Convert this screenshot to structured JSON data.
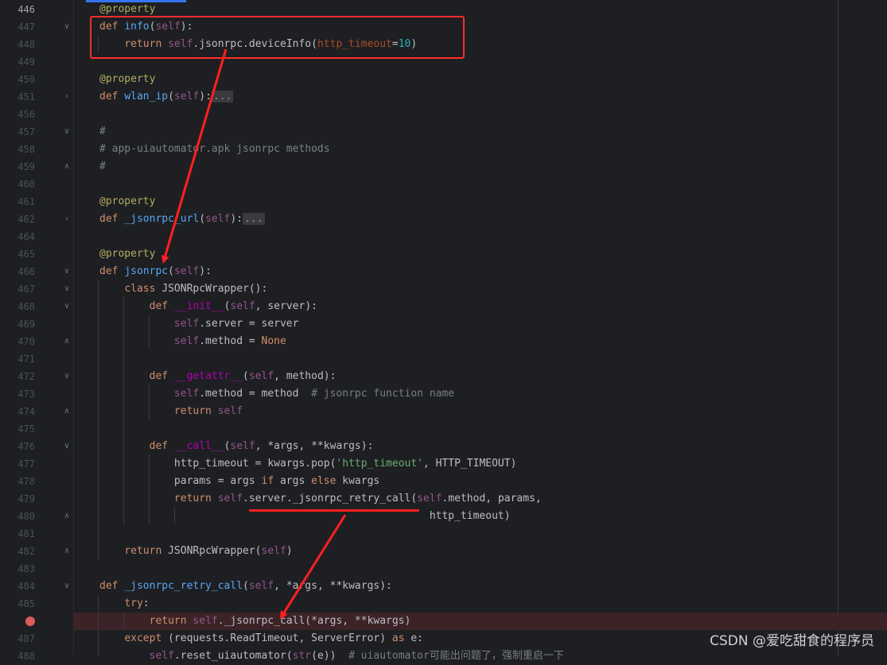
{
  "lines": [
    {
      "n": "446",
      "tokens": [
        [
          "dec",
          "@property"
        ]
      ]
    },
    {
      "n": "447",
      "fold": "v",
      "tokens": [
        [
          "k",
          "def "
        ],
        [
          "f",
          "info"
        ],
        [
          "",
          "("
        ],
        [
          "s",
          "self"
        ],
        [
          "",
          "):"
        ]
      ]
    },
    {
      "n": "448",
      "tokens": [
        [
          "",
          "    "
        ],
        [
          "k",
          "return "
        ],
        [
          "s",
          "self"
        ],
        [
          "",
          ".jsonrpc.deviceInfo("
        ],
        [
          "param",
          "http_timeout"
        ],
        [
          "",
          "="
        ],
        [
          "num",
          "10"
        ],
        [
          "",
          ")"
        ]
      ]
    },
    {
      "n": "449",
      "tokens": []
    },
    {
      "n": "450",
      "tokens": [
        [
          "dec",
          "@property"
        ]
      ]
    },
    {
      "n": "451",
      "fold": ">",
      "tokens": [
        [
          "k",
          "def "
        ],
        [
          "f",
          "wlan_ip"
        ],
        [
          "",
          "("
        ],
        [
          "s",
          "self"
        ],
        [
          "",
          "):"
        ],
        [
          "fb",
          "..."
        ]
      ]
    },
    {
      "n": "456",
      "tokens": []
    },
    {
      "n": "457",
      "fold": "v",
      "tokens": [
        [
          "cm",
          "#"
        ]
      ]
    },
    {
      "n": "458",
      "tokens": [
        [
          "cm",
          "# app-uiautomator.apk jsonrpc methods"
        ]
      ]
    },
    {
      "n": "459",
      "fold": "^",
      "tokens": [
        [
          "cm",
          "#"
        ]
      ]
    },
    {
      "n": "460",
      "tokens": []
    },
    {
      "n": "461",
      "tokens": [
        [
          "dec",
          "@property"
        ]
      ]
    },
    {
      "n": "462",
      "fold": ">",
      "tokens": [
        [
          "k",
          "def "
        ],
        [
          "f",
          "_jsonrpc_url"
        ],
        [
          "",
          "("
        ],
        [
          "s",
          "self"
        ],
        [
          "",
          "):"
        ],
        [
          "fb",
          "..."
        ]
      ]
    },
    {
      "n": "464",
      "tokens": []
    },
    {
      "n": "465",
      "tokens": [
        [
          "dec",
          "@property"
        ]
      ]
    },
    {
      "n": "466",
      "fold": "v",
      "tokens": [
        [
          "k",
          "def "
        ],
        [
          "f",
          "jsonrpc"
        ],
        [
          "",
          "("
        ],
        [
          "s",
          "self"
        ],
        [
          "",
          "):"
        ]
      ]
    },
    {
      "n": "467",
      "fold": "v",
      "tokens": [
        [
          "",
          "    "
        ],
        [
          "k",
          "class "
        ],
        [
          "",
          "JSONRpcWrapper():"
        ]
      ]
    },
    {
      "n": "468",
      "fold": "v",
      "tokens": [
        [
          "",
          "        "
        ],
        [
          "k",
          "def "
        ],
        [
          "dunder",
          "__init__"
        ],
        [
          "",
          "("
        ],
        [
          "s",
          "self"
        ],
        [
          "",
          ", server):"
        ]
      ]
    },
    {
      "n": "469",
      "tokens": [
        [
          "",
          "            "
        ],
        [
          "s",
          "self"
        ],
        [
          "",
          ".server = server"
        ]
      ]
    },
    {
      "n": "470",
      "fold": "^",
      "tokens": [
        [
          "",
          "            "
        ],
        [
          "s",
          "self"
        ],
        [
          "",
          ".method = "
        ],
        [
          "k",
          "None"
        ]
      ]
    },
    {
      "n": "471",
      "tokens": []
    },
    {
      "n": "472",
      "fold": "v",
      "tokens": [
        [
          "",
          "        "
        ],
        [
          "k",
          "def "
        ],
        [
          "dunder",
          "__getattr__"
        ],
        [
          "",
          "("
        ],
        [
          "s",
          "self"
        ],
        [
          "",
          ", method):"
        ]
      ]
    },
    {
      "n": "473",
      "tokens": [
        [
          "",
          "            "
        ],
        [
          "s",
          "self"
        ],
        [
          "",
          ".method = method  "
        ],
        [
          "cm",
          "# jsonrpc function name"
        ]
      ]
    },
    {
      "n": "474",
      "fold": "^",
      "tokens": [
        [
          "",
          "            "
        ],
        [
          "k",
          "return "
        ],
        [
          "s",
          "self"
        ]
      ]
    },
    {
      "n": "475",
      "tokens": []
    },
    {
      "n": "476",
      "fold": "v",
      "tokens": [
        [
          "",
          "        "
        ],
        [
          "k",
          "def "
        ],
        [
          "dunder",
          "__call__"
        ],
        [
          "",
          "("
        ],
        [
          "s",
          "self"
        ],
        [
          "",
          ", *args, **kwargs):"
        ]
      ]
    },
    {
      "n": "477",
      "tokens": [
        [
          "",
          "            http_timeout = kwargs.pop("
        ],
        [
          "str",
          "'http_timeout'"
        ],
        [
          "",
          ", HTTP_TIMEOUT)"
        ]
      ]
    },
    {
      "n": "478",
      "tokens": [
        [
          "",
          "            params = args "
        ],
        [
          "k",
          "if "
        ],
        [
          "",
          "args "
        ],
        [
          "k",
          "else "
        ],
        [
          "",
          "kwargs"
        ]
      ]
    },
    {
      "n": "479",
      "tokens": [
        [
          "",
          "            "
        ],
        [
          "k",
          "return "
        ],
        [
          "s",
          "self"
        ],
        [
          "",
          ".server._jsonrpc_retry_call("
        ],
        [
          "s",
          "self"
        ],
        [
          "",
          ".method, params,"
        ]
      ]
    },
    {
      "n": "480",
      "fold": "^",
      "tokens": [
        [
          "",
          "                                                     http_timeout)"
        ]
      ]
    },
    {
      "n": "481",
      "tokens": []
    },
    {
      "n": "482",
      "fold": "^",
      "tokens": [
        [
          "",
          "    "
        ],
        [
          "k",
          "return "
        ],
        [
          "",
          "JSONRpcWrapper("
        ],
        [
          "s",
          "self"
        ],
        [
          "",
          ")"
        ]
      ]
    },
    {
      "n": "483",
      "tokens": []
    },
    {
      "n": "484",
      "fold": "v",
      "tokens": [
        [
          "k",
          "def "
        ],
        [
          "f",
          "_jsonrpc_retry_call"
        ],
        [
          "",
          "("
        ],
        [
          "s",
          "self"
        ],
        [
          "",
          ", *args, **kwargs):"
        ]
      ]
    },
    {
      "n": "485",
      "tokens": [
        [
          "",
          "    "
        ],
        [
          "k",
          "try"
        ],
        [
          "",
          ":"
        ]
      ]
    },
    {
      "n": "",
      "bp": true,
      "tokens": [
        [
          "",
          "        "
        ],
        [
          "k",
          "return "
        ],
        [
          "s",
          "self"
        ],
        [
          "",
          "._jsonrpc_call(*args, **kwargs)"
        ]
      ]
    },
    {
      "n": "487",
      "tokens": [
        [
          "",
          "    "
        ],
        [
          "k",
          "except "
        ],
        [
          "",
          "(requests.ReadTimeout, ServerError) "
        ],
        [
          "k",
          "as "
        ],
        [
          "",
          "e:"
        ]
      ]
    },
    {
      "n": "488",
      "tokens": [
        [
          "",
          "        "
        ],
        [
          "s",
          "self"
        ],
        [
          "",
          ".reset_uiautomator("
        ],
        [
          "s",
          "str"
        ],
        [
          "",
          "(e))  "
        ],
        [
          "cm",
          "# uiautomator可能出问题了，强制重启一下"
        ]
      ]
    }
  ],
  "current_line": "446",
  "watermark": "CSDN @爱吃甜食的程序员"
}
